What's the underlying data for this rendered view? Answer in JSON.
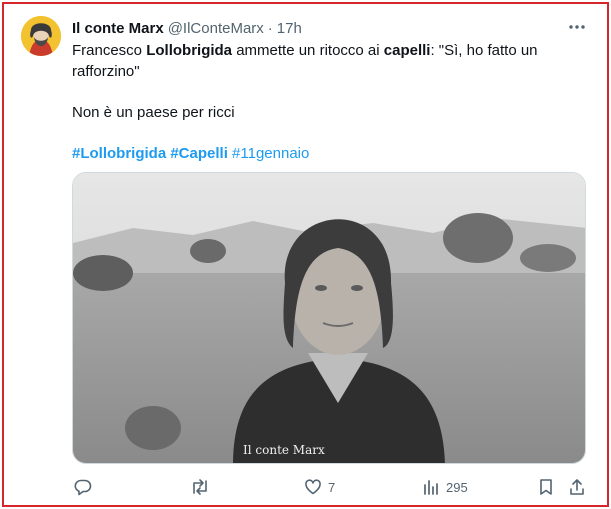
{
  "tweet": {
    "author_name": "Il conte Marx",
    "handle": "@IlConteMarx",
    "separator": "·",
    "time": "17h",
    "text_pre": "Francesco ",
    "text_bold1": "Lollobrigida",
    "text_mid": " ammette un ritocco ai ",
    "text_bold2": "capelli",
    "text_post": ": \"Sì, ho fatto un rafforzino\"",
    "line2": "Non è un paese per ricci",
    "hashtags": [
      "#Lollobrigida",
      "#Capelli",
      "#11gennaio"
    ],
    "image_watermark": "Il conte Marx"
  },
  "actions": {
    "replies": "",
    "retweets": "",
    "likes": "7",
    "views": "295"
  },
  "colors": {
    "frame": "#d6262b",
    "link": "#1d9bf0",
    "muted": "#536471",
    "text": "#0f1419"
  },
  "icons": {
    "more": "more-options-icon",
    "reply": "reply-icon",
    "retweet": "retweet-icon",
    "like": "heart-icon",
    "views": "views-chart-icon",
    "bookmark": "bookmark-icon",
    "share": "share-icon"
  }
}
